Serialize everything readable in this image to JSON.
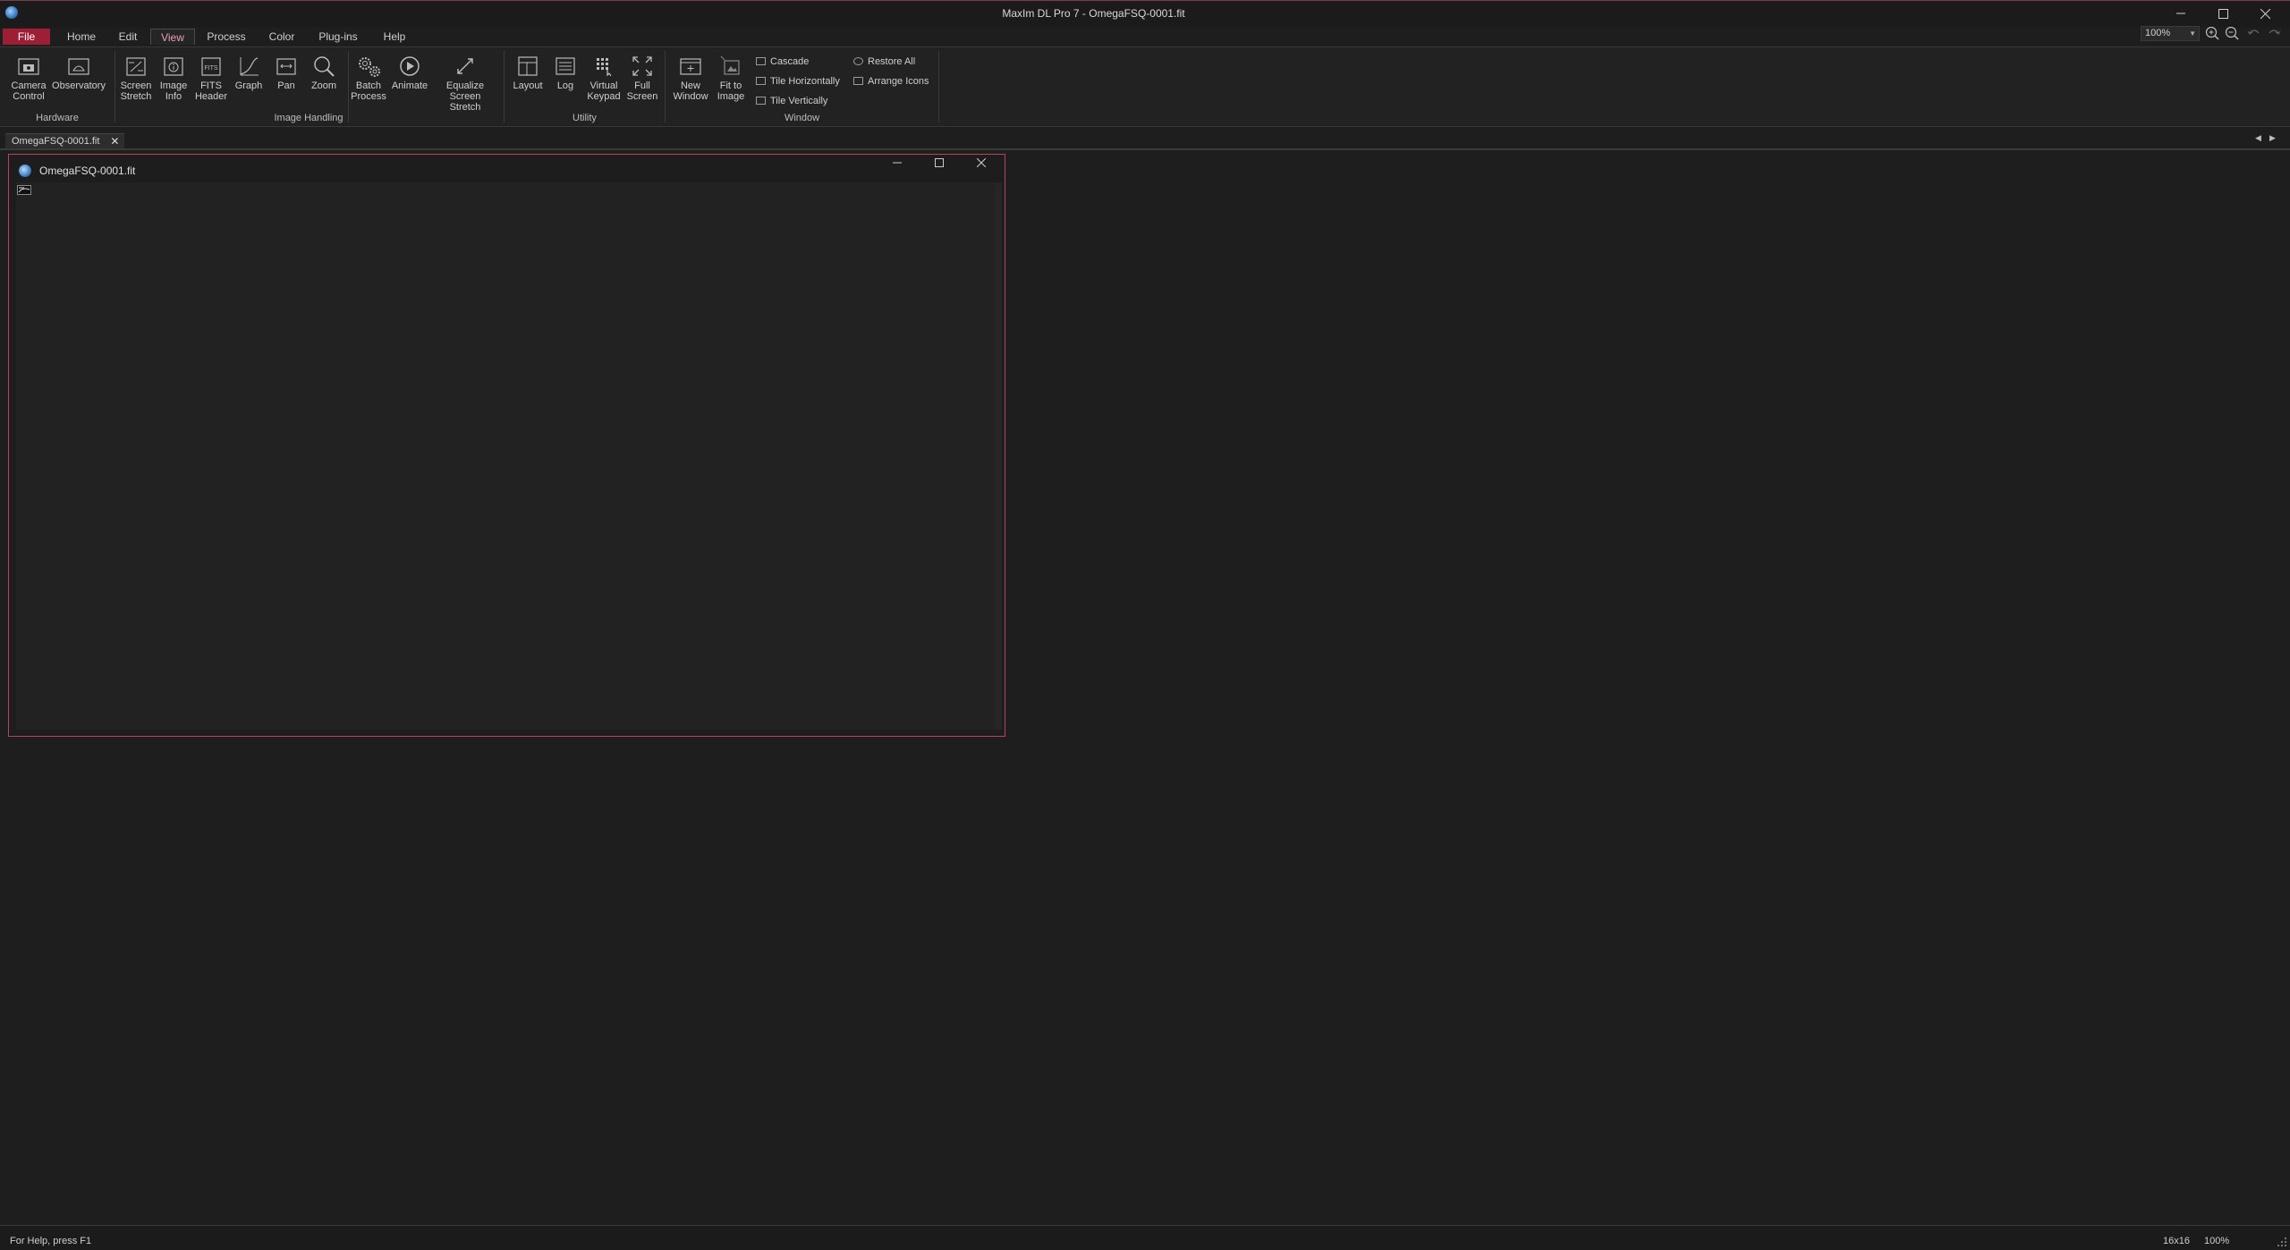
{
  "window": {
    "title": "MaxIm DL Pro 7 - OmegaFSQ-0001.fit",
    "controls": [
      "minimize-icon",
      "maximize-icon",
      "close-icon"
    ]
  },
  "menu": {
    "file": "File",
    "home": "Home",
    "edit": "Edit",
    "view": "View",
    "process": "Process",
    "color": "Color",
    "plugins": "Plug-ins",
    "help": "Help",
    "active": "View"
  },
  "quick_access": {
    "zoom_value": "100%",
    "icons": [
      "zoom-in-icon",
      "zoom-out-icon",
      "undo-icon",
      "redo-icon"
    ]
  },
  "ribbon": {
    "hardware": {
      "label": "Hardware",
      "camera_control_1": "Camera",
      "camera_control_2": "Control",
      "observatory": "Observatory"
    },
    "image_handling": {
      "label": "Image Handling",
      "screen_stretch_1": "Screen",
      "screen_stretch_2": "Stretch",
      "image_info_1": "Image",
      "image_info_2": "Info",
      "fits_header_1": "FITS",
      "fits_header_2": "Header",
      "graph": "Graph",
      "pan": "Pan",
      "zoom": "Zoom",
      "batch_process_1": "Batch",
      "batch_process_2": "Process",
      "animate": "Animate",
      "equalize_1": "Equalize",
      "equalize_2": "Screen Stretch"
    },
    "utility": {
      "label": "Utility",
      "layout": "Layout",
      "log": "Log",
      "virtual_keypad_1": "Virtual",
      "virtual_keypad_2": "Keypad",
      "full_screen_1": "Full",
      "full_screen_2": "Screen"
    },
    "window_group": {
      "label": "Window",
      "new_window_1": "New",
      "new_window_2": "Window",
      "fit_to_image_1": "Fit to",
      "fit_to_image_2": "Image",
      "cascade": "Cascade",
      "tile_horizontally": "Tile Horizontally",
      "tile_vertically": "Tile Vertically",
      "restore_all": "Restore All",
      "arrange_icons": "Arrange Icons"
    }
  },
  "doc_tabs": [
    {
      "label": "OmegaFSQ-0001.fit",
      "active": true
    }
  ],
  "child_window": {
    "title": "OmegaFSQ-0001.fit"
  },
  "status": {
    "help": "For Help, press F1",
    "size": "16x16",
    "zoom": "100%"
  },
  "colors": {
    "accent": "#9c1f35",
    "frame": "#b7445f",
    "background": "#1e1e1e"
  }
}
